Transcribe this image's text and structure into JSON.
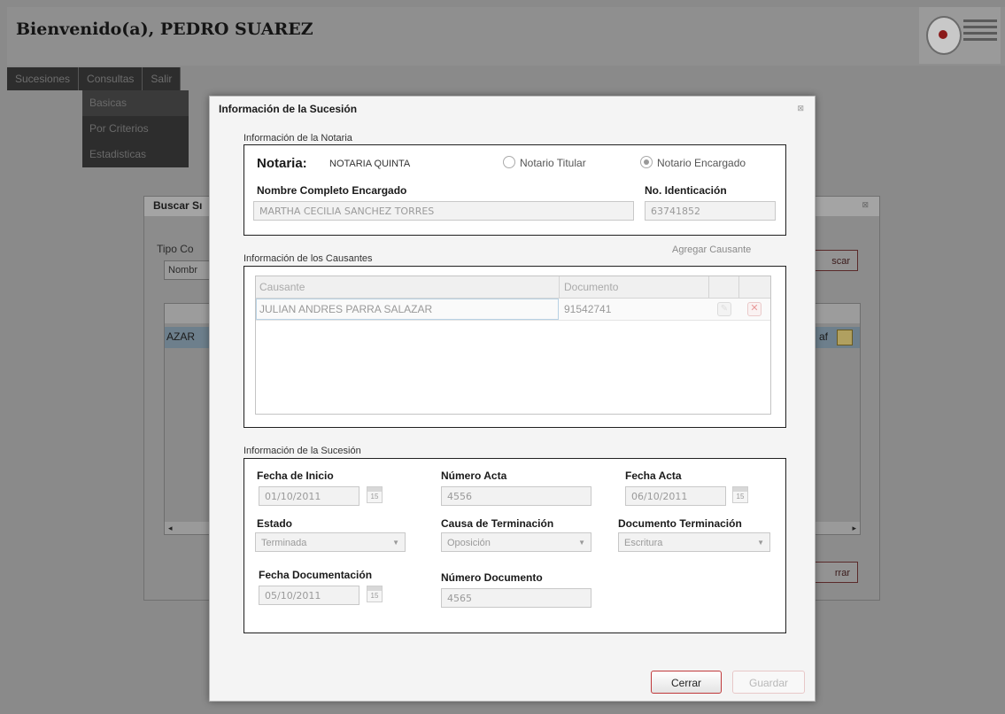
{
  "header": {
    "welcome": "Bienvenido(a), PEDRO SUAREZ"
  },
  "menu": {
    "items": [
      "Sucesiones",
      "Consultas",
      "Salir"
    ],
    "submenu": [
      "Basicas",
      "Por Criterios",
      "Estadisticas"
    ]
  },
  "bg_dialog": {
    "title": "Buscar Sı",
    "tipo_label": "Tipo Co",
    "select_value": "Nombr",
    "buscar_btn": "scar",
    "cerrar_btn": "rrar",
    "row_text": "AZAR",
    "row_tail": "af"
  },
  "modal": {
    "title": "Información de la Sucesión",
    "close": "⊠",
    "notaria_section": {
      "title": "Información de la Notaria",
      "notaria_label": "Notaria:",
      "notaria_value": "NOTARIA QUINTA",
      "radio_titular": "Notario Titular",
      "radio_encargado": "Notario Encargado",
      "nombre_label": "Nombre Completo Encargado",
      "nombre_value": "MARTHA CECILIA SANCHEZ TORRES",
      "id_label": "No. Identicación",
      "id_value": "63741852"
    },
    "causantes_section": {
      "title": "Información de los Causantes",
      "add_link": "Agregar Causante",
      "columns": [
        "Causante",
        "Documento"
      ],
      "rows": [
        {
          "causante": "JULIAN ANDRES PARRA SALAZAR",
          "documento": "91542741"
        }
      ]
    },
    "sucesion_section": {
      "title": "Información de la Sucesión",
      "fecha_inicio_label": "Fecha de Inicio",
      "fecha_inicio_value": "01/10/2011",
      "numero_acta_label": "Número Acta",
      "numero_acta_value": "4556",
      "fecha_acta_label": "Fecha Acta",
      "fecha_acta_value": "06/10/2011",
      "estado_label": "Estado",
      "estado_value": "Terminada",
      "causa_label": "Causa de Terminación",
      "causa_value": "Oposición",
      "doc_term_label": "Documento Terminación",
      "doc_term_value": "Escritura",
      "fecha_doc_label": "Fecha Documentación",
      "fecha_doc_value": "05/10/2011",
      "numero_doc_label": "Número Documento",
      "numero_doc_value": "4565",
      "calendar_num": "15"
    },
    "buttons": {
      "cerrar": "Cerrar",
      "guardar": "Guardar"
    }
  }
}
